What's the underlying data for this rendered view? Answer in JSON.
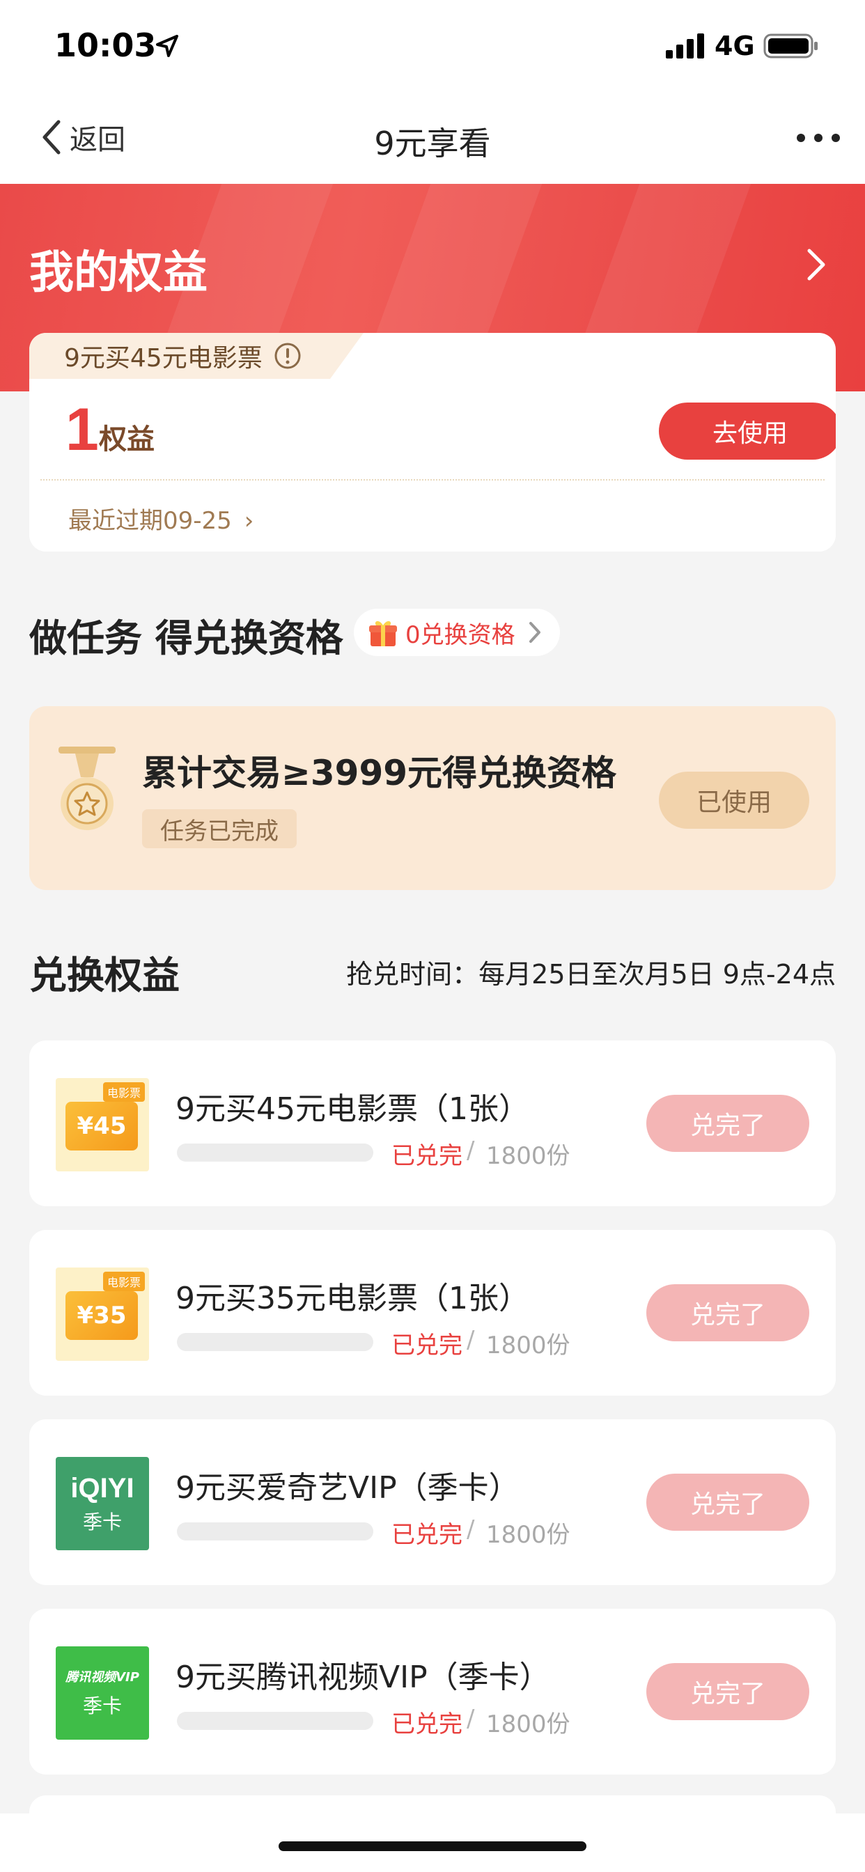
{
  "status_bar": {
    "time": "10:03",
    "network": "4G",
    "icons": [
      "location-arrow-icon",
      "signal-icon",
      "battery-icon"
    ]
  },
  "nav": {
    "back_label": "返回",
    "title": "9元享看",
    "icons": [
      "chevron-left-icon",
      "more-icon"
    ]
  },
  "banner": {
    "title": "我的权益",
    "icon": "chevron-right-icon"
  },
  "rights": {
    "tag": "9元买45元电影票",
    "count": "1",
    "unit": "权益",
    "use_button": "去使用",
    "expiry": "最近过期09-25",
    "expiry_chevron": "›"
  },
  "task_section": {
    "title": "做任务 得兑换资格",
    "qualification": "0兑换资格",
    "task": {
      "name": "累计交易≥3999元得兑换资格",
      "status": "任务已完成",
      "button": "已使用"
    }
  },
  "exchange_section": {
    "title": "兑换权益",
    "time": "抢兑时间：每月25日至次月5日 9点-24点",
    "items": [
      {
        "name": "9元买45元电影票（1张）",
        "thumb_label": "电影票",
        "thumb_value": "¥45",
        "sold": "已兑完",
        "separator": "/",
        "total": "1800份",
        "button": "兑完了"
      },
      {
        "name": "9元买35元电影票（1张）",
        "thumb_label": "电影票",
        "thumb_value": "¥35",
        "sold": "已兑完",
        "separator": "/",
        "total": "1800份",
        "button": "兑完了"
      },
      {
        "name": "9元买爱奇艺VIP（季卡）",
        "thumb_brand": "iQIYI",
        "thumb_sub": "季卡",
        "sold": "已兑完",
        "separator": "/",
        "total": "1800份",
        "button": "兑完了"
      },
      {
        "name": "9元买腾讯视频VIP（季卡）",
        "thumb_brand": "腾讯视频VIP",
        "thumb_sub": "季卡",
        "sold": "已兑完",
        "separator": "/",
        "total": "1800份",
        "button": "兑完了"
      }
    ]
  },
  "colors": {
    "primary_red": "#e8413f",
    "disabled_button": "#f4b5b5",
    "task_bg": "#fbe9d6",
    "page_bg": "#f4f4f4"
  }
}
